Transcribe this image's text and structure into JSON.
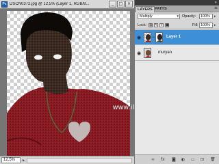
{
  "document": {
    "title": "DSCN0372.jpg @ 12,5% (Layer 1, RGB/8...",
    "app_logo": "Ps",
    "window_buttons": [
      "_",
      "□",
      "×"
    ],
    "zoom": "12,5%"
  },
  "watermark": "www.ilmudesain.web.id",
  "layers_panel": {
    "tabs": [
      {
        "label": "LAYERS",
        "active": true
      },
      {
        "label": "PATHS",
        "active": false
      }
    ],
    "blend_mode": "Multiply",
    "opacity_label": "Opacity:",
    "opacity": "100%",
    "lock_label": "Lock:",
    "fill_label": "Fill:",
    "fill": "100%",
    "layers": [
      {
        "name": "Layer 1",
        "selected": true,
        "visible": true
      },
      {
        "name": "muryan",
        "selected": false,
        "visible": true
      }
    ],
    "bottom_icons": [
      "link-icon",
      "fx-icon",
      "mask-icon",
      "adjustment-icon",
      "group-icon",
      "new-layer-icon",
      "trash-icon"
    ]
  },
  "colors": {
    "selection": "#3d8fd6",
    "panel": "#d6d6d6",
    "canvas_bg": "#767676",
    "shirt": "#8b1a22"
  }
}
